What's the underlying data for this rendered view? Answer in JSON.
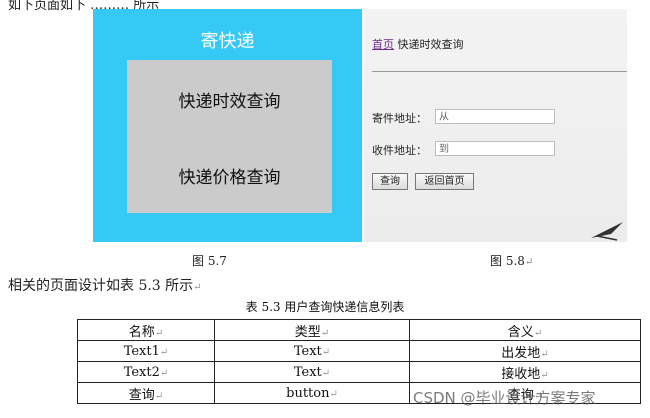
{
  "top_cut_text": "如下页面如下  ……… 所示",
  "figure_57": {
    "title": "寄快递",
    "menu_items": [
      "快递时效查询",
      "快递价格查询"
    ],
    "caption": "图 5.7"
  },
  "figure_58": {
    "breadcrumb_link": "首页",
    "breadcrumb_text": "快递时效查询",
    "sender_label": "寄件地址：",
    "sender_placeholder": "从",
    "receiver_label": "收件地址：",
    "receiver_placeholder": "到",
    "query_button": "查询",
    "home_button": "返回首页",
    "caption": "图 5.8"
  },
  "paragraph": "相关的页面设计如表 5.3 所示",
  "table_caption": "表 5.3 用户查询快递信息列表",
  "table": {
    "headers": [
      "名称",
      "类型",
      "含义"
    ],
    "rows": [
      [
        "Text1",
        "Text",
        "出发地"
      ],
      [
        "Text2",
        "Text",
        "接收地"
      ],
      [
        "查询",
        "button",
        "查询"
      ]
    ]
  },
  "watermark": "CSDN @毕业设计方案专家"
}
